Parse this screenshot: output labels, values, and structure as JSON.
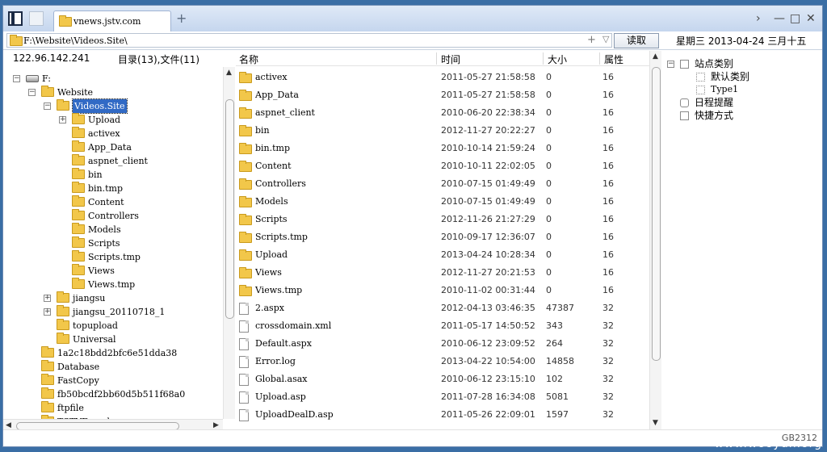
{
  "tab": {
    "title": "vnews.jstv.com"
  },
  "window_controls": {
    "forward": "›",
    "minimize": "—",
    "maximize": "□",
    "close": "✕"
  },
  "address": {
    "path": "F:\\Website\\Videos.Site\\",
    "plus": "+",
    "drop": "▽",
    "read_label": "读取"
  },
  "date": "星期三 2013-04-24 三月十五",
  "tree_header": {
    "ip": "122.96.142.241",
    "count": "目录(13),文件(11)"
  },
  "tree": [
    {
      "label": "F:",
      "depth": 0,
      "exp": "−",
      "type": "drive"
    },
    {
      "label": "Website",
      "depth": 1,
      "exp": "−",
      "type": "folder"
    },
    {
      "label": "Videos.Site",
      "depth": 2,
      "exp": "−",
      "type": "folder",
      "selected": true
    },
    {
      "label": "Upload",
      "depth": 3,
      "exp": "+",
      "type": "folder"
    },
    {
      "label": "activex",
      "depth": 3,
      "exp": "",
      "type": "folder"
    },
    {
      "label": "App_Data",
      "depth": 3,
      "exp": "",
      "type": "folder"
    },
    {
      "label": "aspnet_client",
      "depth": 3,
      "exp": "",
      "type": "folder"
    },
    {
      "label": "bin",
      "depth": 3,
      "exp": "",
      "type": "folder"
    },
    {
      "label": "bin.tmp",
      "depth": 3,
      "exp": "",
      "type": "folder"
    },
    {
      "label": "Content",
      "depth": 3,
      "exp": "",
      "type": "folder"
    },
    {
      "label": "Controllers",
      "depth": 3,
      "exp": "",
      "type": "folder"
    },
    {
      "label": "Models",
      "depth": 3,
      "exp": "",
      "type": "folder"
    },
    {
      "label": "Scripts",
      "depth": 3,
      "exp": "",
      "type": "folder"
    },
    {
      "label": "Scripts.tmp",
      "depth": 3,
      "exp": "",
      "type": "folder"
    },
    {
      "label": "Views",
      "depth": 3,
      "exp": "",
      "type": "folder"
    },
    {
      "label": "Views.tmp",
      "depth": 3,
      "exp": "",
      "type": "folder"
    },
    {
      "label": "jiangsu",
      "depth": 2,
      "exp": "+",
      "type": "folder"
    },
    {
      "label": "jiangsu_20110718_1",
      "depth": 2,
      "exp": "+",
      "type": "folder"
    },
    {
      "label": "topupload",
      "depth": 2,
      "exp": "",
      "type": "folder"
    },
    {
      "label": "Universal",
      "depth": 2,
      "exp": "",
      "type": "folder"
    },
    {
      "label": "1a2c18bdd2bfc6e51dda38",
      "depth": 1,
      "exp": "",
      "type": "folder"
    },
    {
      "label": "Database",
      "depth": 1,
      "exp": "",
      "type": "folder"
    },
    {
      "label": "FastCopy",
      "depth": 1,
      "exp": "",
      "type": "folder"
    },
    {
      "label": "fb50bcdf2bb60d5b511f68a0",
      "depth": 1,
      "exp": "",
      "type": "folder"
    },
    {
      "label": "ftpfile",
      "depth": 1,
      "exp": "",
      "type": "folder"
    },
    {
      "label": "TSTVEncoder",
      "depth": 1,
      "exp": "",
      "type": "folder"
    }
  ],
  "columns": {
    "name": "名称",
    "time": "时间",
    "size": "大小",
    "attr": "属性"
  },
  "files": [
    {
      "name": "activex",
      "time": "2011-05-27 21:58:58",
      "size": "0",
      "attr": "16",
      "type": "folder"
    },
    {
      "name": "App_Data",
      "time": "2011-05-27 21:58:58",
      "size": "0",
      "attr": "16",
      "type": "folder"
    },
    {
      "name": "aspnet_client",
      "time": "2010-06-20 22:38:34",
      "size": "0",
      "attr": "16",
      "type": "folder"
    },
    {
      "name": "bin",
      "time": "2012-11-27 20:22:27",
      "size": "0",
      "attr": "16",
      "type": "folder"
    },
    {
      "name": "bin.tmp",
      "time": "2010-10-14 21:59:24",
      "size": "0",
      "attr": "16",
      "type": "folder"
    },
    {
      "name": "Content",
      "time": "2010-10-11 22:02:05",
      "size": "0",
      "attr": "16",
      "type": "folder"
    },
    {
      "name": "Controllers",
      "time": "2010-07-15 01:49:49",
      "size": "0",
      "attr": "16",
      "type": "folder"
    },
    {
      "name": "Models",
      "time": "2010-07-15 01:49:49",
      "size": "0",
      "attr": "16",
      "type": "folder"
    },
    {
      "name": "Scripts",
      "time": "2012-11-26 21:27:29",
      "size": "0",
      "attr": "16",
      "type": "folder"
    },
    {
      "name": "Scripts.tmp",
      "time": "2010-09-17 12:36:07",
      "size": "0",
      "attr": "16",
      "type": "folder"
    },
    {
      "name": "Upload",
      "time": "2013-04-24 10:28:34",
      "size": "0",
      "attr": "16",
      "type": "folder"
    },
    {
      "name": "Views",
      "time": "2012-11-27 20:21:53",
      "size": "0",
      "attr": "16",
      "type": "folder"
    },
    {
      "name": "Views.tmp",
      "time": "2010-11-02 00:31:44",
      "size": "0",
      "attr": "16",
      "type": "folder"
    },
    {
      "name": "2.aspx",
      "time": "2012-04-13 03:46:35",
      "size": "47387",
      "attr": "32",
      "type": "file"
    },
    {
      "name": "crossdomain.xml",
      "time": "2011-05-17 14:50:52",
      "size": "343",
      "attr": "32",
      "type": "file"
    },
    {
      "name": "Default.aspx",
      "time": "2010-06-12 23:09:52",
      "size": "264",
      "attr": "32",
      "type": "file"
    },
    {
      "name": "Error.log",
      "time": "2013-04-22 10:54:00",
      "size": "14858",
      "attr": "32",
      "type": "file"
    },
    {
      "name": "Global.asax",
      "time": "2010-06-12 23:15:10",
      "size": "102",
      "attr": "32",
      "type": "file"
    },
    {
      "name": "Upload.asp",
      "time": "2011-07-28 16:34:08",
      "size": "5081",
      "attr": "32",
      "type": "file"
    },
    {
      "name": "UploadDealD.asp",
      "time": "2011-05-26 22:09:01",
      "size": "1597",
      "attr": "32",
      "type": "file"
    }
  ],
  "right_panel": {
    "site_category": "站点类别",
    "default_category": "默认类别",
    "type1": "Type1",
    "schedule": "日程提醒",
    "shortcut": "快捷方式"
  },
  "status": {
    "code": "GB2312"
  },
  "watermark": "www.wooyun.org"
}
